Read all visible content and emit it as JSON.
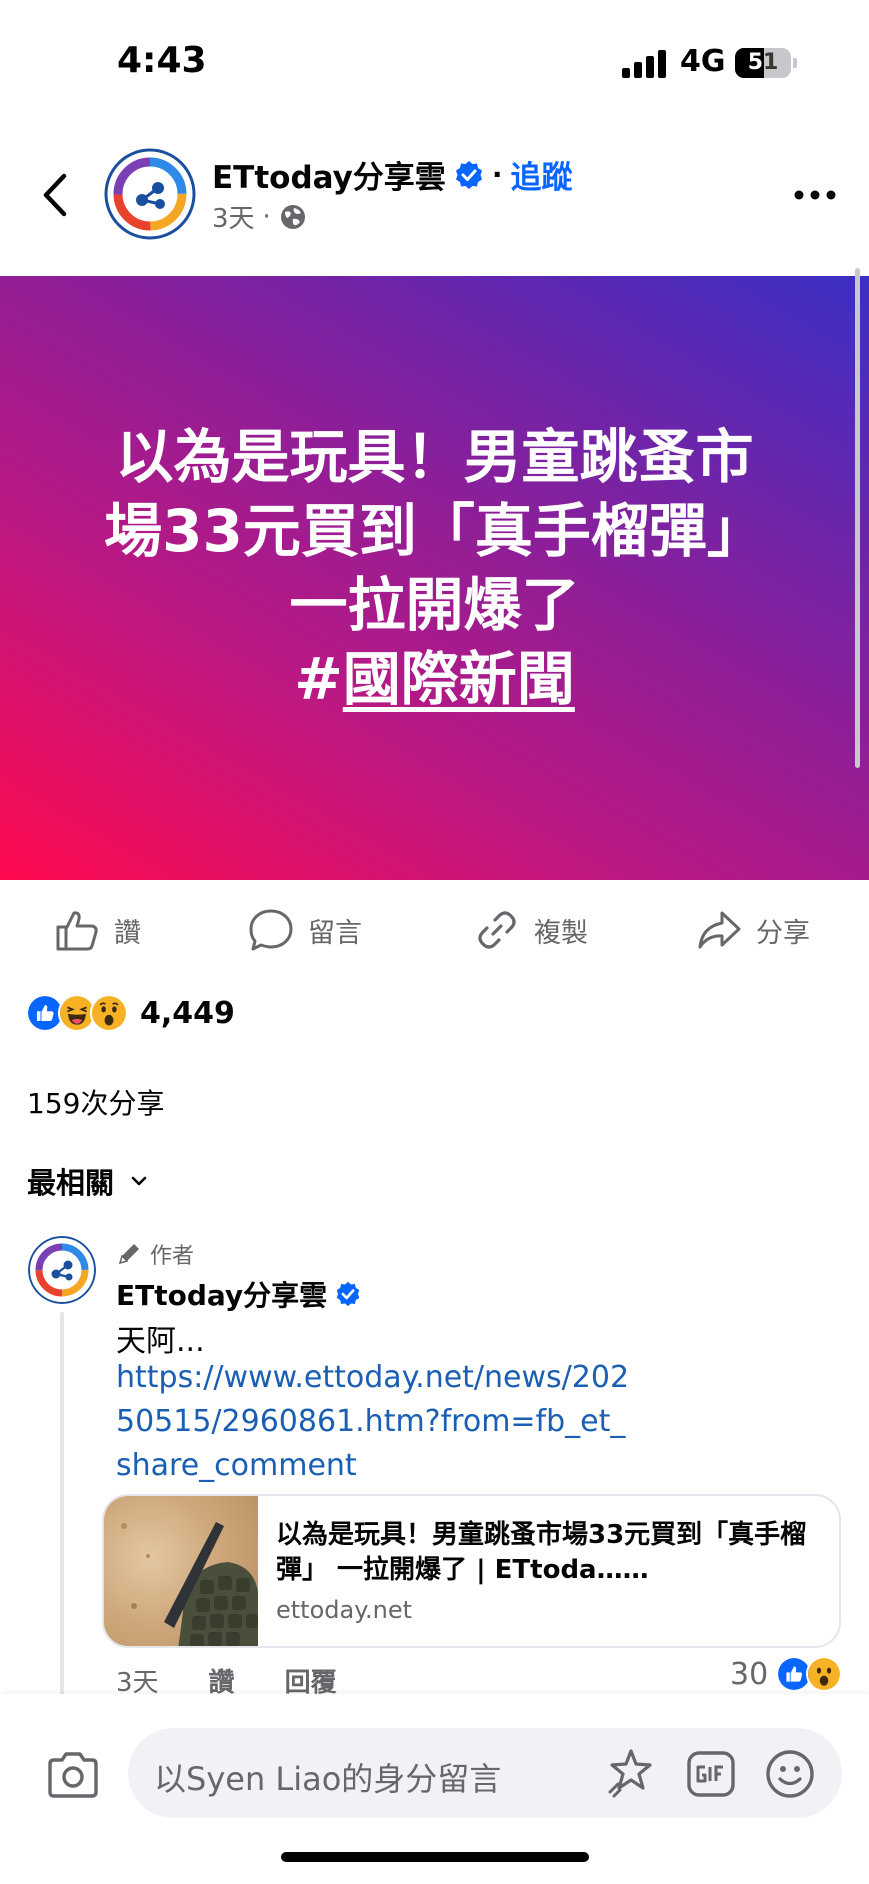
{
  "status_bar": {
    "time": "4:43",
    "network": "4G",
    "battery": "51",
    "battery_level": 0.51
  },
  "header": {
    "page_name": "ETtoday分享雲",
    "separator": "·",
    "follow_label": "追蹤",
    "post_time": "3天",
    "meta_separator": "·"
  },
  "banner": {
    "line1": "以為是玩具！男童跳蚤市",
    "line2": "場33元買到「真手榴彈」",
    "line3": "一拉開爆了",
    "hashtag_prefix": "#",
    "hashtag": "國際新聞"
  },
  "actions": {
    "like": "讚",
    "comment": "留言",
    "copy": "複製",
    "share": "分享"
  },
  "reactions": {
    "count": "4,449"
  },
  "shares": {
    "label": "159次分享"
  },
  "sort": {
    "label": "最相關"
  },
  "comment": {
    "badge": "作者",
    "author": "ETtoday分享雲",
    "text": "天阿...",
    "link": "https://www.ettoday.net/news/20250515/2960861.htm?from=fb_et_share_comment",
    "card": {
      "title": "以為是玩具！男童跳蚤市場33元買到「真手榴彈」 一拉開爆了 | ETtoda……",
      "domain": "ettoday.net"
    },
    "time": "3天",
    "like_label": "讚",
    "reply_label": "回覆",
    "reaction_count": "30"
  },
  "composer": {
    "placeholder": "以Syen  Liao的身分留言"
  },
  "colors": {
    "facebook_blue": "#0866ff",
    "link_blue": "#1a5fb4",
    "banner_start": "#ff0a4f",
    "banner_end": "#3b2fc4"
  }
}
